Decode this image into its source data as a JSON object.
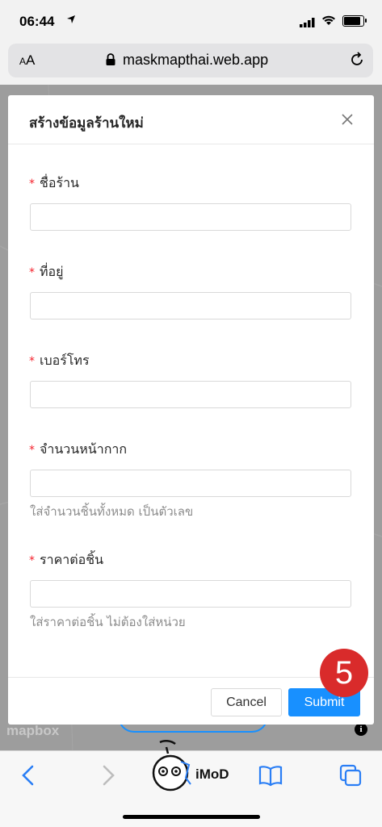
{
  "status_bar": {
    "time": "06:44"
  },
  "url_bar": {
    "aa_small": "A",
    "aa_large": "A",
    "url": "maskmapthai.web.app"
  },
  "modal": {
    "title": "สร้างข้อมูลร้านใหม่",
    "fields": [
      {
        "label": "ชื่อร้าน",
        "value": "",
        "help": ""
      },
      {
        "label": "ที่อยู่",
        "value": "",
        "help": ""
      },
      {
        "label": "เบอร์โทร",
        "value": "",
        "help": ""
      },
      {
        "label": "จำนวนหน้ากาก",
        "value": "",
        "help": "ใส่จำนวนชิ้นทั้งหมด เป็นตัวเลข"
      },
      {
        "label": "ราคาต่อชิ้น",
        "value": "",
        "help": "ใส่ราคาต่อชิ้น ไม่ต้องใส่หน่วย"
      }
    ],
    "required_mark": "*",
    "cancel_label": "Cancel",
    "submit_label": "Submit"
  },
  "annotation": {
    "step_number": "5"
  },
  "map": {
    "attribution": "mapbox",
    "info_label": "i"
  },
  "watermark": {
    "text": "iMoD"
  },
  "colors": {
    "primary": "#1890ff",
    "required": "#f5222d",
    "badge": "#d92b2b"
  }
}
